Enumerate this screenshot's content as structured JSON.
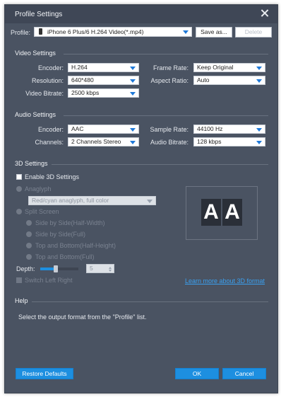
{
  "window": {
    "title": "Profile Settings"
  },
  "profile": {
    "label": "Profile:",
    "value": "iPhone 6 Plus/6 H.264 Video(*.mp4)",
    "save_as": "Save as...",
    "delete": "Delete"
  },
  "video": {
    "heading": "Video Settings",
    "encoder_label": "Encoder:",
    "encoder_value": "H.264",
    "resolution_label": "Resolution:",
    "resolution_value": "640*480",
    "bitrate_label": "Video Bitrate:",
    "bitrate_value": "2500 kbps",
    "framerate_label": "Frame Rate:",
    "framerate_value": "Keep Original",
    "aspect_label": "Aspect Ratio:",
    "aspect_value": "Auto"
  },
  "audio": {
    "heading": "Audio Settings",
    "encoder_label": "Encoder:",
    "encoder_value": "AAC",
    "channels_label": "Channels:",
    "channels_value": "2 Channels Stereo",
    "samplerate_label": "Sample Rate:",
    "samplerate_value": "44100 Hz",
    "bitrate_label": "Audio Bitrate:",
    "bitrate_value": "128 kbps"
  },
  "threed": {
    "heading": "3D Settings",
    "enable_label": "Enable 3D Settings",
    "anaglyph_label": "Anaglyph",
    "anaglyph_value": "Red/cyan anaglyph, full color",
    "split_label": "Split Screen",
    "split_options": [
      "Side by Side(Half-Width)",
      "Side by Side(Full)",
      "Top and Bottom(Half-Height)",
      "Top and Bottom(Full)"
    ],
    "depth_label": "Depth:",
    "depth_value": "5",
    "depth_slider_fraction": 0.4,
    "switch_label": "Switch Left Right",
    "learn_more": "Learn more about 3D format",
    "preview_text": [
      "A",
      "A"
    ]
  },
  "help": {
    "heading": "Help",
    "text": "Select the output format from the \"Profile\" list."
  },
  "footer": {
    "restore": "Restore Defaults",
    "ok": "OK",
    "cancel": "Cancel"
  },
  "colors": {
    "accent": "#1d8fe0",
    "panel": "#4a5362",
    "titlebar": "#3f4756",
    "link": "#3aa0f0"
  }
}
